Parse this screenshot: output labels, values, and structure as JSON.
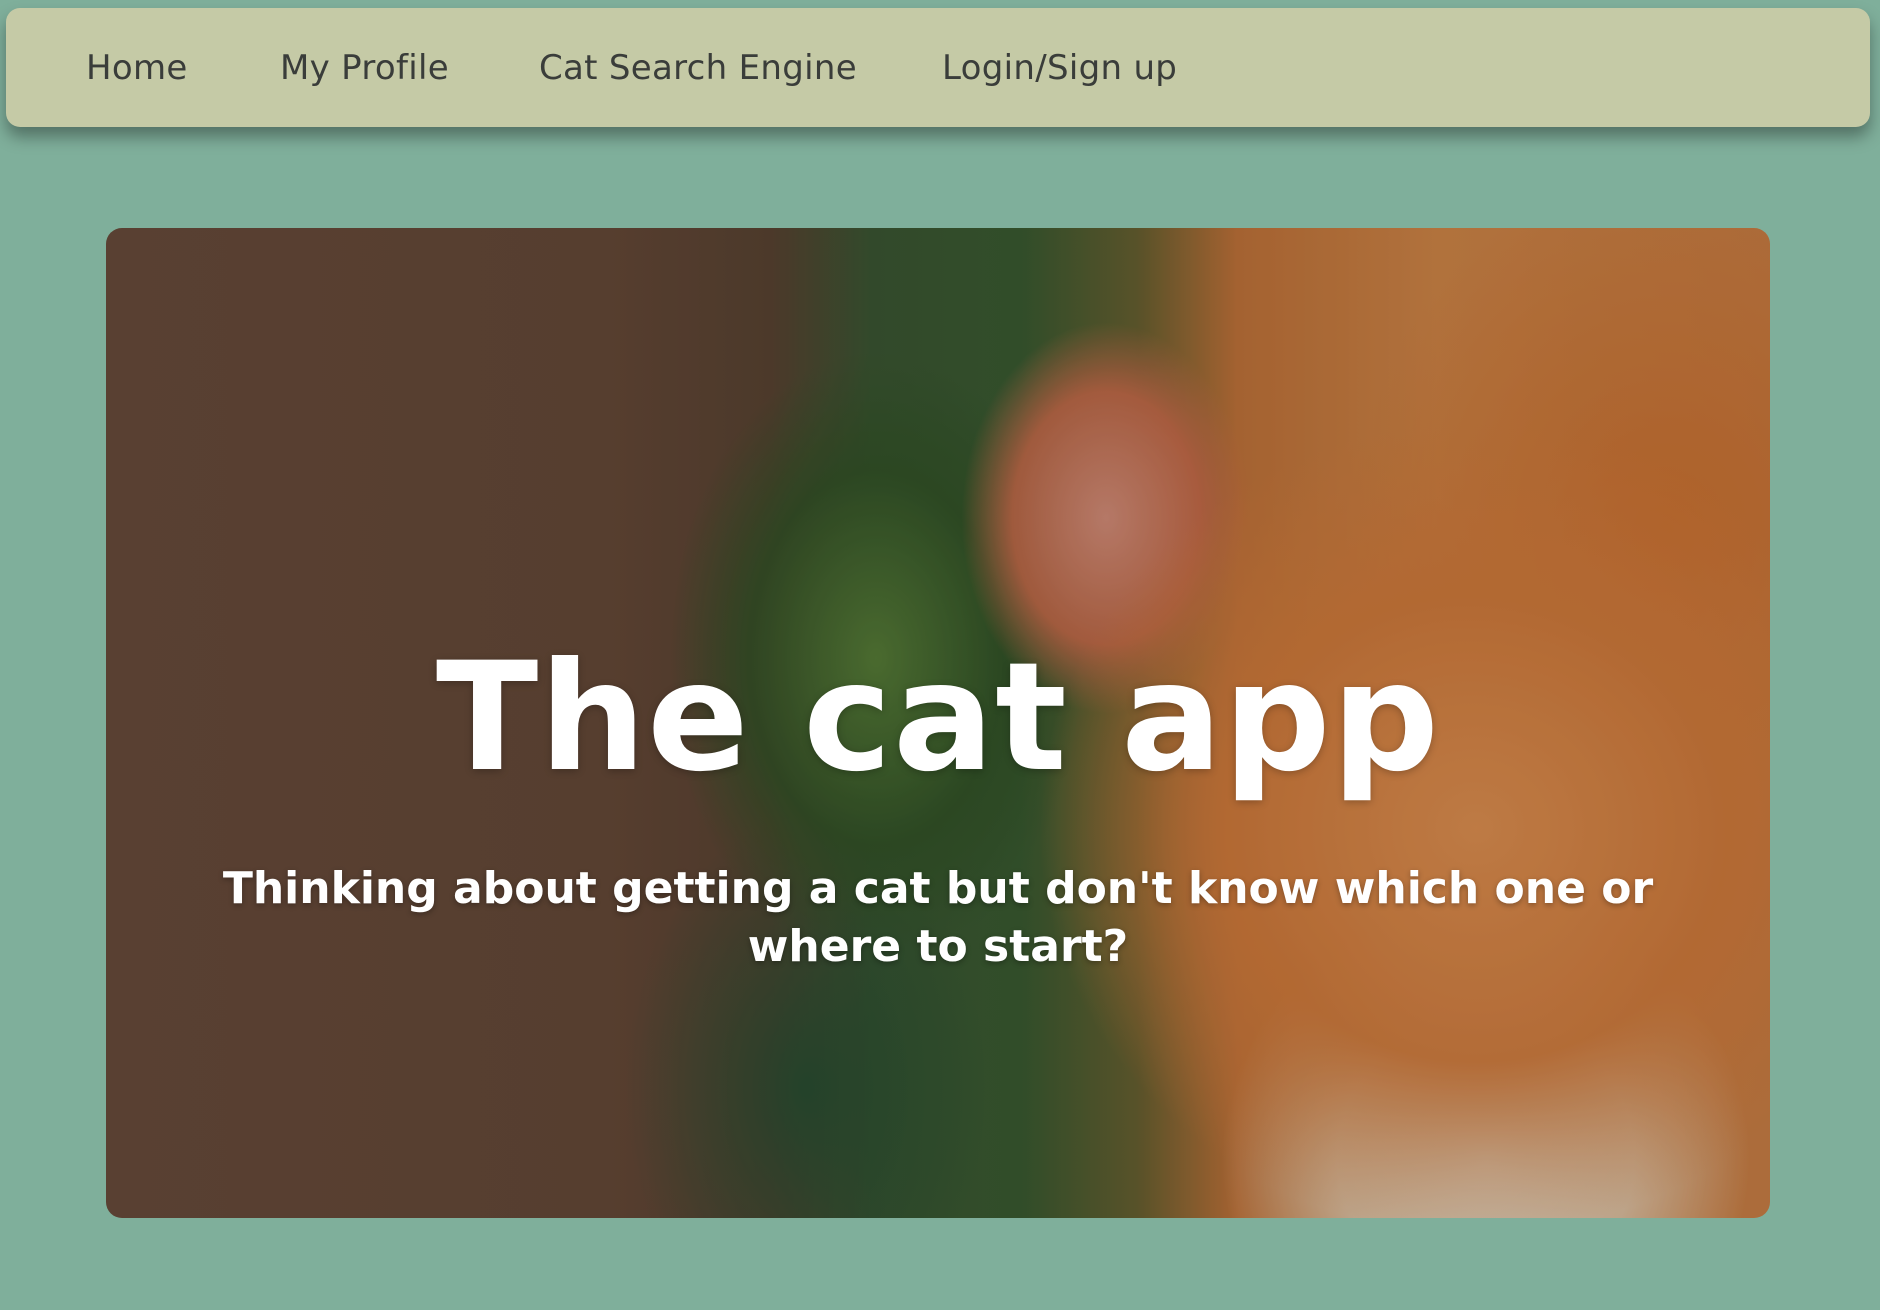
{
  "nav": {
    "items": [
      {
        "label": "Home"
      },
      {
        "label": "My Profile"
      },
      {
        "label": "Cat Search Engine"
      },
      {
        "label": "Login/Sign up"
      }
    ]
  },
  "hero": {
    "title": "The cat app",
    "subtitle": "Thinking about getting a cat but don't know which one or where to start?",
    "image": "orange-tabby-cat-photo"
  },
  "colors": {
    "page_background": "#7faf9b",
    "navbar_background": "#c5caa6",
    "nav_text": "#3a3d3a",
    "hero_text": "#ffffff"
  }
}
